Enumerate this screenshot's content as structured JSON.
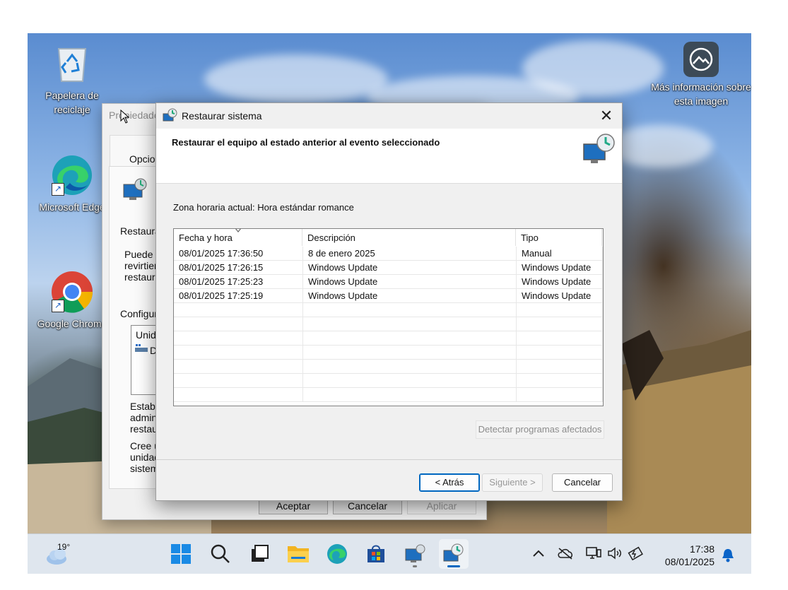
{
  "desktop": {
    "icons": [
      {
        "label": "Papelera de reciclaje"
      },
      {
        "label": "Microsoft Edge"
      },
      {
        "label": "Google Chrome"
      },
      {
        "label": "Más información sobre esta imagen"
      }
    ]
  },
  "background_dialog": {
    "title": "Propiedades",
    "tab_label": "Opcion",
    "section_restore": "Restaura",
    "text_block_1": [
      "Puede d",
      "revirtien",
      "restaura"
    ],
    "section_config": "Configura",
    "list_header": "Unid",
    "list_item": "D",
    "text_block_2": [
      "Establ",
      "admin",
      "restau"
    ],
    "text_block_3": [
      "Cree u",
      "unidad",
      "sistem"
    ],
    "buttons": {
      "ok": "Aceptar",
      "cancel": "Cancelar",
      "apply": "Aplicar"
    }
  },
  "dialog": {
    "title": "Restaurar sistema",
    "header_title": "Restaurar el equipo al estado anterior al evento seleccionado",
    "timezone_text": "Zona horaria actual: Hora estándar romance",
    "table": {
      "columns": [
        "Fecha y hora",
        "Descripción",
        "Tipo"
      ],
      "rows": [
        {
          "date": "08/01/2025 17:36:50",
          "description": "8 de enero 2025",
          "type": "Manual"
        },
        {
          "date": "08/01/2025 17:26:15",
          "description": "Windows Update",
          "type": "Windows Update"
        },
        {
          "date": "08/01/2025 17:25:23",
          "description": "Windows Update",
          "type": "Windows Update"
        },
        {
          "date": "08/01/2025 17:25:19",
          "description": "Windows Update",
          "type": "Windows Update"
        }
      ]
    },
    "detect_button": "Detectar programas afectados",
    "buttons": {
      "back": "< Atrás",
      "next": "Siguiente >",
      "cancel": "Cancelar"
    }
  },
  "taskbar": {
    "weather_temp": "19°",
    "apps": [
      "start-icon",
      "search-icon",
      "task-view-icon",
      "file-explorer-icon",
      "edge-icon",
      "store-icon",
      "system-properties-icon",
      "system-restore-icon"
    ],
    "clock_time": "17:38",
    "clock_date": "08/01/2025"
  },
  "colors": {
    "accent": "#0067c0",
    "taskbar_bg": "#dfe6ee",
    "dialog_bg": "#f0f0f0"
  }
}
